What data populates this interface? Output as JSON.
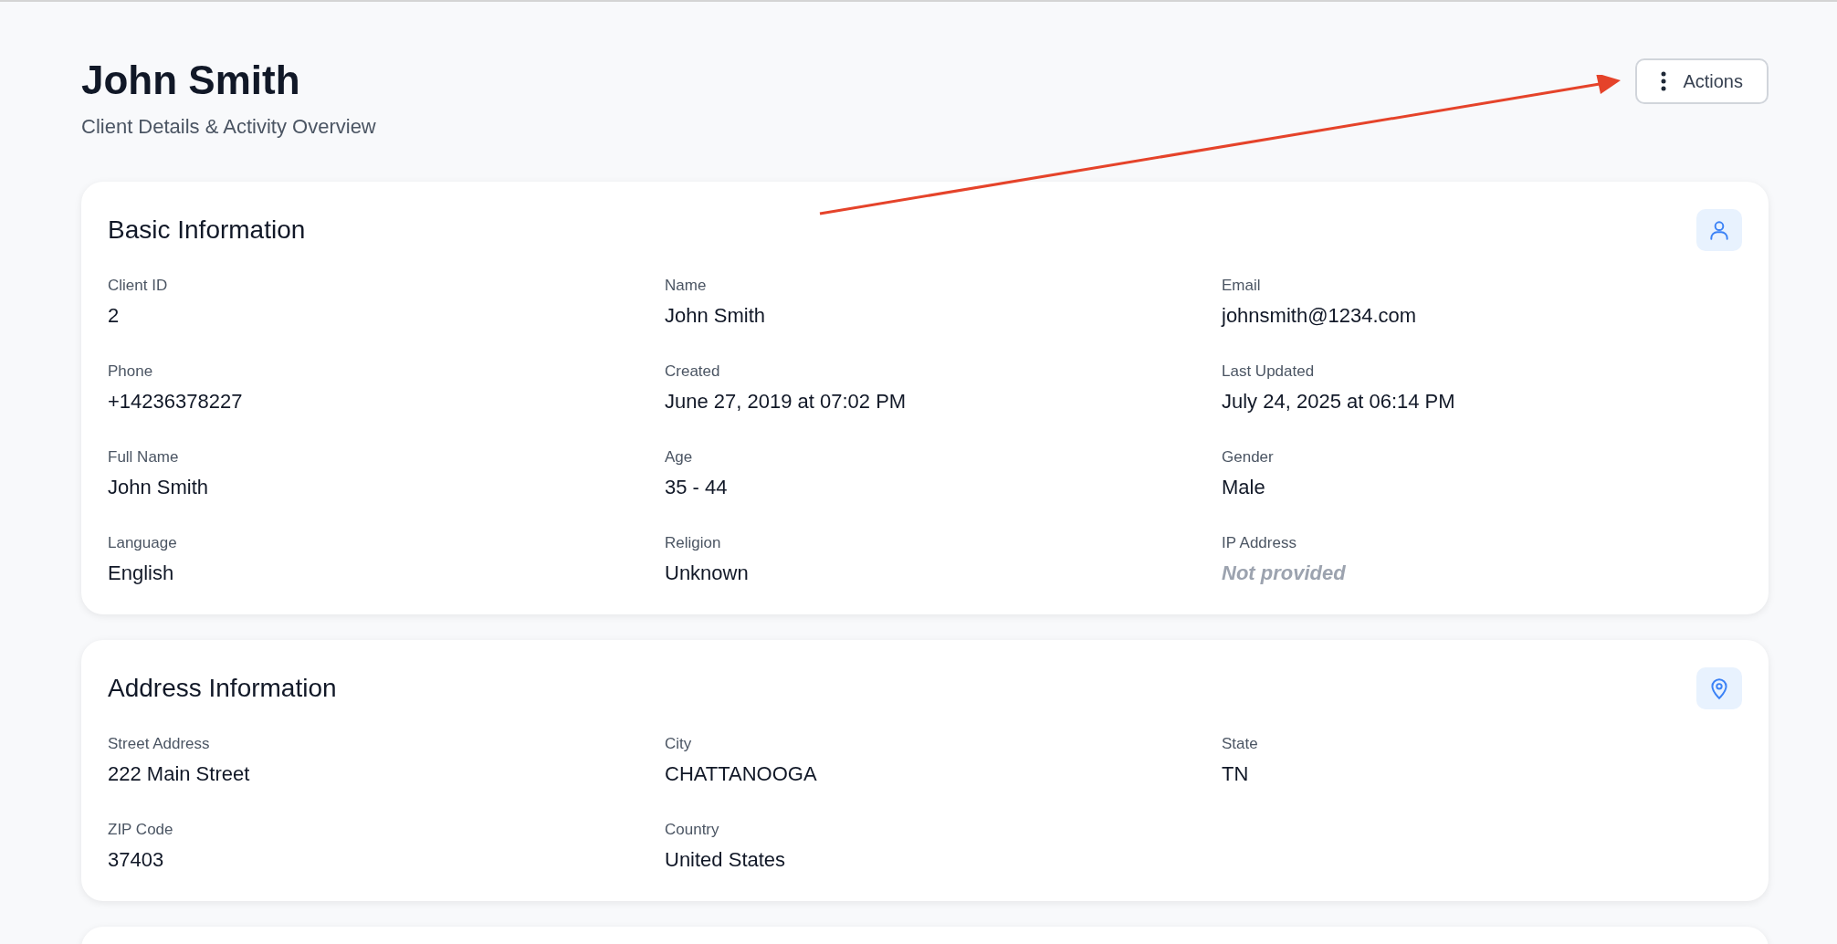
{
  "header": {
    "title": "John Smith",
    "subtitle": "Client Details & Activity Overview",
    "actions_button": "Actions"
  },
  "cards": [
    {
      "title": "Basic Information",
      "kind": "person",
      "fields": [
        {
          "label": "Client ID",
          "value": "2",
          "kind": "text"
        },
        {
          "label": "Name",
          "value": "John Smith",
          "kind": "text"
        },
        {
          "label": "Email",
          "value": "johnsmith@1234.com",
          "kind": "text"
        },
        {
          "label": "Phone",
          "value": "+14236378227",
          "kind": "text"
        },
        {
          "label": "Created",
          "value": "June 27, 2019 at 07:02 PM",
          "kind": "text"
        },
        {
          "label": "Last Updated",
          "value": "July 24, 2025 at 06:14 PM",
          "kind": "text"
        },
        {
          "label": "Full Name",
          "value": "John Smith",
          "kind": "text"
        },
        {
          "label": "Age",
          "value": "35 - 44",
          "kind": "text"
        },
        {
          "label": "Gender",
          "value": "Male",
          "kind": "text"
        },
        {
          "label": "Language",
          "value": "English",
          "kind": "text"
        },
        {
          "label": "Religion",
          "value": "Unknown",
          "kind": "text"
        },
        {
          "label": "IP Address",
          "value": "Not provided",
          "kind": "empty"
        }
      ]
    },
    {
      "title": "Address Information",
      "kind": "pin",
      "fields": [
        {
          "label": "Street Address",
          "value": "222 Main Street",
          "kind": "text"
        },
        {
          "label": "City",
          "value": "CHATTANOOGA",
          "kind": "text"
        },
        {
          "label": "State",
          "value": "TN",
          "kind": "text"
        },
        {
          "label": "ZIP Code",
          "value": "37403",
          "kind": "text"
        },
        {
          "label": "Country",
          "value": "United States",
          "kind": "text"
        }
      ]
    }
  ]
}
